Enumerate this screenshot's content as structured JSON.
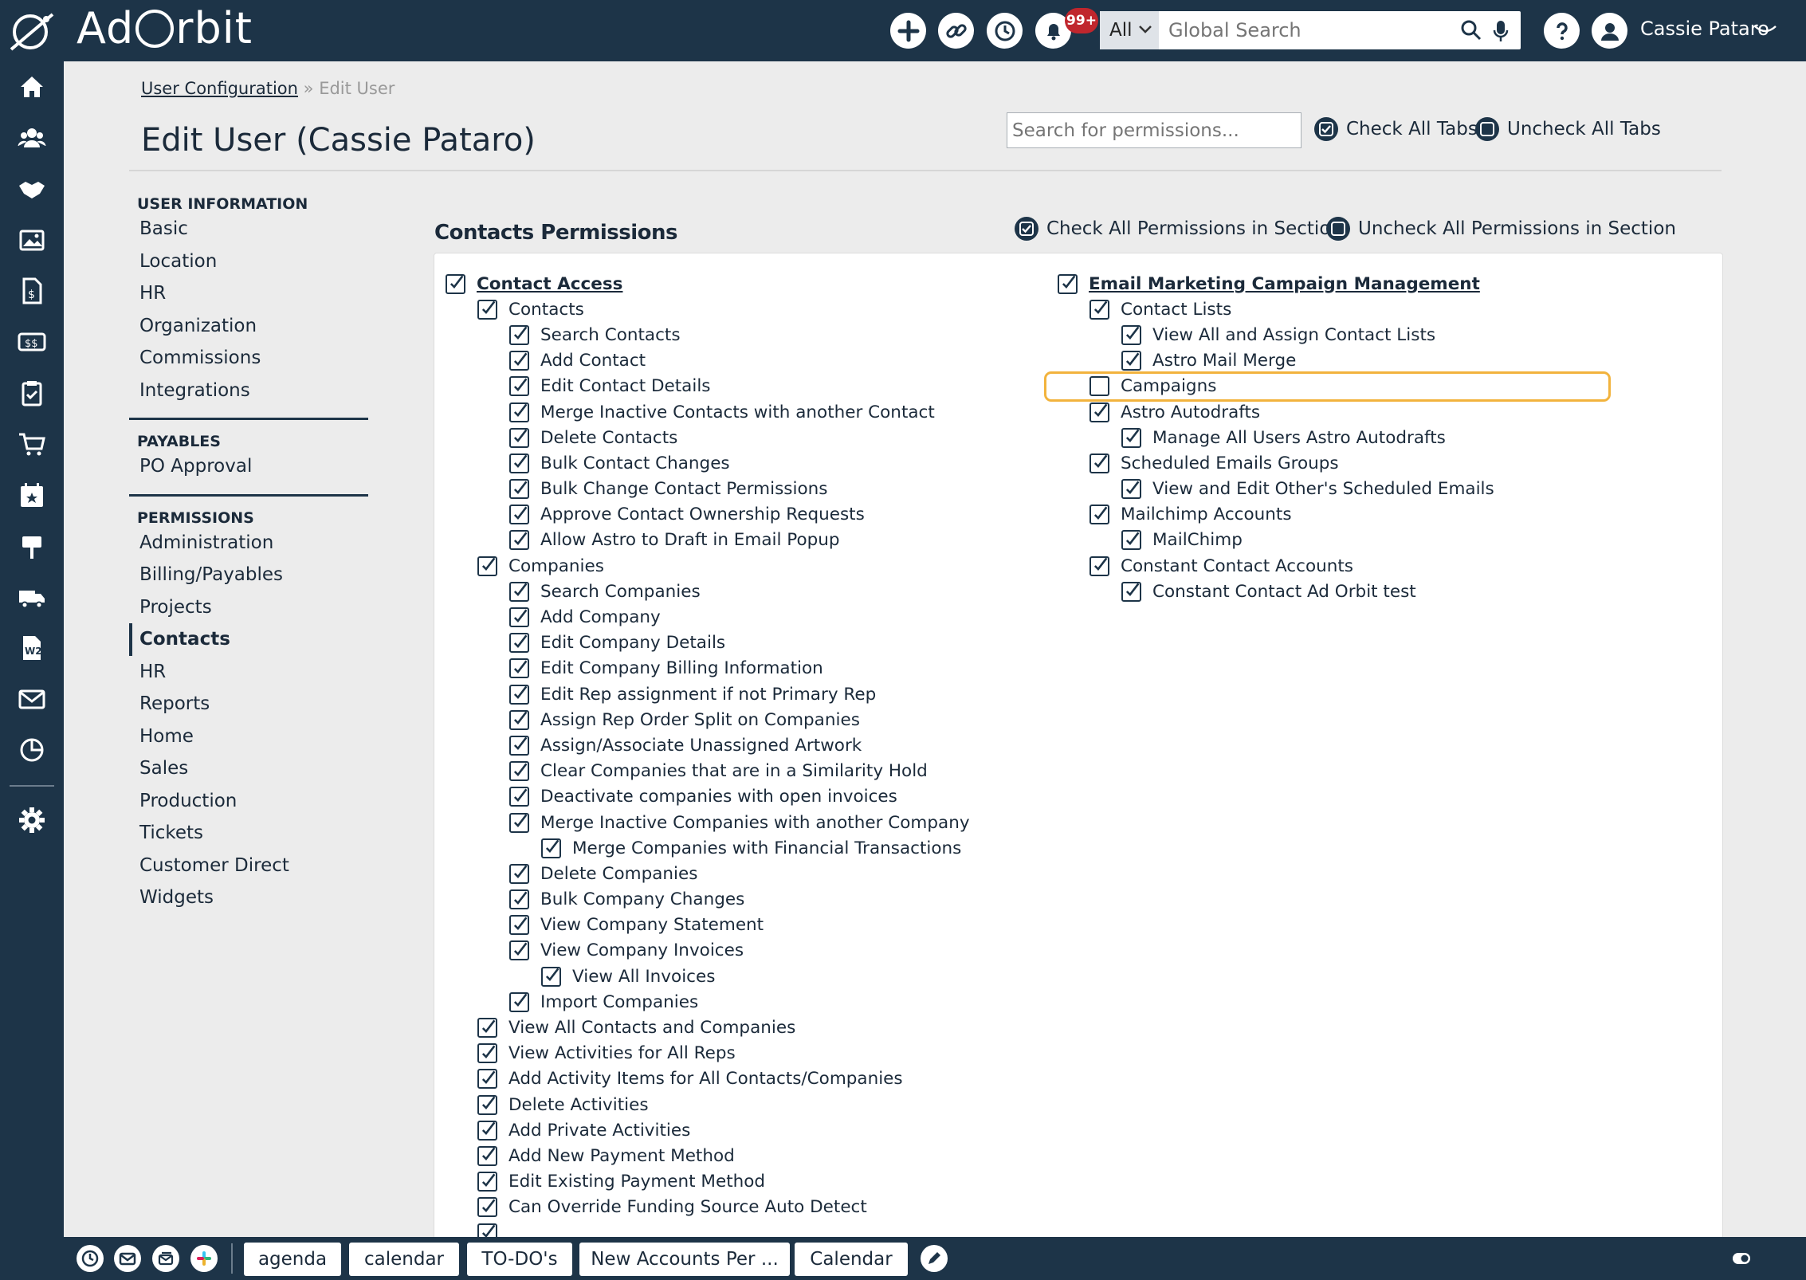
{
  "app": {
    "name": "Ad Orbit",
    "name_left": "Ad",
    "name_right": "rbit"
  },
  "header": {
    "notifications_badge": "99+",
    "search": {
      "scope": "All",
      "placeholder": "Global Search"
    },
    "user_name": "Cassie Pataro"
  },
  "breadcrumb": {
    "parent": "User Configuration",
    "separator": "»",
    "current": "Edit User"
  },
  "page_title": "Edit User (Cassie Pataro)",
  "permission_search": {
    "placeholder": "Search for permissions..."
  },
  "tab_actions": {
    "check_all": "Check All Tabs",
    "uncheck_all": "Uncheck All Tabs"
  },
  "subnav": {
    "user_information": {
      "heading": "USER INFORMATION",
      "items": [
        "Basic",
        "Location",
        "HR",
        "Organization",
        "Commissions",
        "Integrations"
      ]
    },
    "payables": {
      "heading": "PAYABLES",
      "items": [
        "PO Approval"
      ]
    },
    "permissions": {
      "heading": "PERMISSIONS",
      "items": [
        "Administration",
        "Billing/Payables",
        "Projects",
        "Contacts",
        "HR",
        "Reports",
        "Home",
        "Sales",
        "Production",
        "Tickets",
        "Customer Direct",
        "Widgets"
      ],
      "active": "Contacts"
    }
  },
  "section": {
    "title": "Contacts Permissions",
    "check_all": "Check All Permissions in Section",
    "uncheck_all": "Uncheck All Permissions in Section"
  },
  "permissions_left": [
    {
      "label": "Contact Access",
      "level": 0,
      "checked": true
    },
    {
      "label": "Contacts",
      "level": 1,
      "checked": true
    },
    {
      "label": "Search Contacts",
      "level": 2,
      "checked": true
    },
    {
      "label": "Add Contact",
      "level": 2,
      "checked": true
    },
    {
      "label": "Edit Contact Details",
      "level": 2,
      "checked": true
    },
    {
      "label": "Merge Inactive Contacts with another Contact",
      "level": 2,
      "checked": true
    },
    {
      "label": "Delete Contacts",
      "level": 2,
      "checked": true
    },
    {
      "label": "Bulk Contact Changes",
      "level": 2,
      "checked": true
    },
    {
      "label": "Bulk Change Contact Permissions",
      "level": 2,
      "checked": true
    },
    {
      "label": "Approve Contact Ownership Requests",
      "level": 2,
      "checked": true
    },
    {
      "label": "Allow Astro to Draft in Email Popup",
      "level": 2,
      "checked": true
    },
    {
      "label": "Companies",
      "level": 1,
      "checked": true
    },
    {
      "label": "Search Companies",
      "level": 2,
      "checked": true
    },
    {
      "label": "Add Company",
      "level": 2,
      "checked": true
    },
    {
      "label": "Edit Company Details",
      "level": 2,
      "checked": true
    },
    {
      "label": "Edit Company Billing Information",
      "level": 2,
      "checked": true
    },
    {
      "label": "Edit Rep assignment if not Primary Rep",
      "level": 2,
      "checked": true
    },
    {
      "label": "Assign Rep Order Split on Companies",
      "level": 2,
      "checked": true
    },
    {
      "label": "Assign/Associate Unassigned Artwork",
      "level": 2,
      "checked": true
    },
    {
      "label": "Clear Companies that are in a Similarity Hold",
      "level": 2,
      "checked": true
    },
    {
      "label": "Deactivate companies with open invoices",
      "level": 2,
      "checked": true
    },
    {
      "label": "Merge Inactive Companies with another Company",
      "level": 2,
      "checked": true
    },
    {
      "label": "Merge Companies with Financial Transactions",
      "level": 3,
      "checked": true
    },
    {
      "label": "Delete Companies",
      "level": 2,
      "checked": true
    },
    {
      "label": "Bulk Company Changes",
      "level": 2,
      "checked": true
    },
    {
      "label": "View Company Statement",
      "level": 2,
      "checked": true
    },
    {
      "label": "View Company Invoices",
      "level": 2,
      "checked": true
    },
    {
      "label": "View All Invoices",
      "level": 3,
      "checked": true
    },
    {
      "label": "Import Companies",
      "level": 2,
      "checked": true
    },
    {
      "label": "View All Contacts and Companies",
      "level": 1,
      "checked": true
    },
    {
      "label": "View Activities for All Reps",
      "level": 1,
      "checked": true
    },
    {
      "label": "Add Activity Items for All Contacts/Companies",
      "level": 1,
      "checked": true
    },
    {
      "label": "Delete Activities",
      "level": 1,
      "checked": true
    },
    {
      "label": "Add Private Activities",
      "level": 1,
      "checked": true
    },
    {
      "label": "Add New Payment Method",
      "level": 1,
      "checked": true
    },
    {
      "label": "Edit Existing Payment Method",
      "level": 1,
      "checked": true
    },
    {
      "label": "Can Override Funding Source Auto Detect",
      "level": 1,
      "checked": true
    },
    {
      "label": "",
      "level": 1,
      "checked": true
    }
  ],
  "permissions_right": [
    {
      "label": "Email Marketing Campaign Management",
      "level": 0,
      "checked": true
    },
    {
      "label": "Contact Lists",
      "level": 1,
      "checked": true
    },
    {
      "label": "View All and Assign Contact Lists",
      "level": 2,
      "checked": true
    },
    {
      "label": "Astro Mail Merge",
      "level": 2,
      "checked": true
    },
    {
      "label": "Campaigns",
      "level": 1,
      "checked": false,
      "highlighted": true
    },
    {
      "label": "Astro Autodrafts",
      "level": 1,
      "checked": true
    },
    {
      "label": "Manage All Users Astro Autodrafts",
      "level": 2,
      "checked": true
    },
    {
      "label": "Scheduled Emails Groups",
      "level": 1,
      "checked": true
    },
    {
      "label": "View and Edit Other's Scheduled Emails",
      "level": 2,
      "checked": true
    },
    {
      "label": "Mailchimp Accounts",
      "level": 1,
      "checked": true
    },
    {
      "label": "MailChimp",
      "level": 2,
      "checked": true
    },
    {
      "label": "Constant Contact Accounts",
      "level": 1,
      "checked": true
    },
    {
      "label": "Constant Contact Ad Orbit test",
      "level": 2,
      "checked": true
    }
  ],
  "taskbar": {
    "tabs": [
      "agenda",
      "calendar",
      "TO-DO's",
      "New Accounts Per ...",
      "Calendar"
    ]
  },
  "colors": {
    "navy": "#1d3448",
    "highlight": "#f2b33d",
    "badge": "#c0262d"
  }
}
